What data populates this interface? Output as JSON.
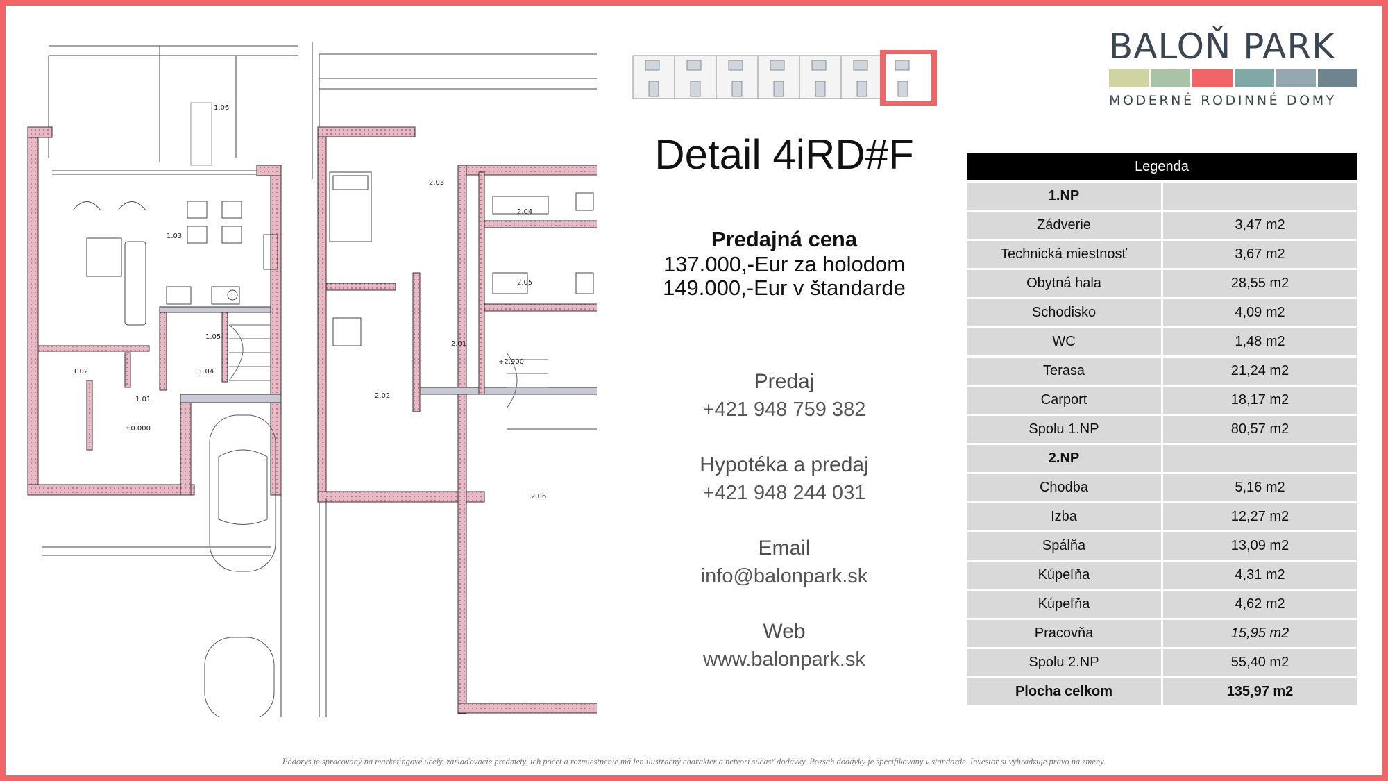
{
  "title": "Detail 4iRD#F",
  "price": {
    "label": "Predajná cena",
    "line1": "137.000,-Eur za holodom",
    "line2": "149.000,-Eur v štandarde"
  },
  "contacts": [
    {
      "label": "Predaj",
      "value": "+421 948 759 382"
    },
    {
      "label": "Hypotéka a predaj",
      "value": "+421 948 244 031"
    },
    {
      "label": "Email",
      "value": "info@balonpark.sk"
    },
    {
      "label": "Web",
      "value": "www.balonpark.sk"
    }
  ],
  "logo": {
    "word": "BALOŇ PARK",
    "subtitle": "MODERNÉ RODINNÉ DOMY",
    "bar_colors": [
      "#cfd4a0",
      "#a8c3a6",
      "#f26566",
      "#7fa8a7",
      "#93a8b0",
      "#6e8590"
    ]
  },
  "colors": {
    "frame": "#f26566",
    "header": "#000000",
    "row": "#d9d9d9",
    "wall": "#e8b9c4"
  },
  "legend": {
    "header": "Legenda",
    "rows": [
      {
        "name": "1.NP",
        "value": "",
        "kind": "section"
      },
      {
        "name": "Zádverie",
        "value": "3,47 m2"
      },
      {
        "name": "Technická miestnosť",
        "value": "3,67 m2"
      },
      {
        "name": "Obytná hala",
        "value": "28,55 m2"
      },
      {
        "name": "Schodisko",
        "value": "4,09 m2"
      },
      {
        "name": "WC",
        "value": "1,48 m2"
      },
      {
        "name": "Terasa",
        "value": "21,24 m2"
      },
      {
        "name": "Carport",
        "value": "18,17 m2"
      },
      {
        "name": "Spolu 1.NP",
        "value": "80,57 m2"
      },
      {
        "name": "2.NP",
        "value": "",
        "kind": "section"
      },
      {
        "name": "Chodba",
        "value": "5,16 m2"
      },
      {
        "name": "Izba",
        "value": "12,27 m2"
      },
      {
        "name": "Spálňa",
        "value": "13,09 m2"
      },
      {
        "name": "Kúpeľňa",
        "value": "4,31 m2"
      },
      {
        "name": "Kúpeľňa",
        "value": "4,62 m2"
      },
      {
        "name": "Pracovňa",
        "value": "15,95 m2",
        "kind": "italic"
      },
      {
        "name": "Spolu 2.NP",
        "value": "55,40 m2"
      },
      {
        "name": "Plocha celkom",
        "value": "135,97 m2",
        "kind": "total"
      }
    ]
  },
  "plan_labels": {
    "ground": [
      "1.06",
      "1.03",
      "1.05",
      "1.04",
      "1.02",
      "1.01",
      "±0.000"
    ],
    "upper": [
      "2.03",
      "2.04",
      "2.05",
      "2.01",
      "2.02",
      "2.06",
      "+2.900"
    ]
  },
  "footnote": "Pôdorys je spracovaný na marketingové účely, zariaďovacie predmety, ich počet a rozmiestnenie má len ilustračný charakter a netvorí súčasť dodávky. Rozsah dodávky je špecifikovaný v štandarde. Investor si vyhradzuje právo na zmeny."
}
